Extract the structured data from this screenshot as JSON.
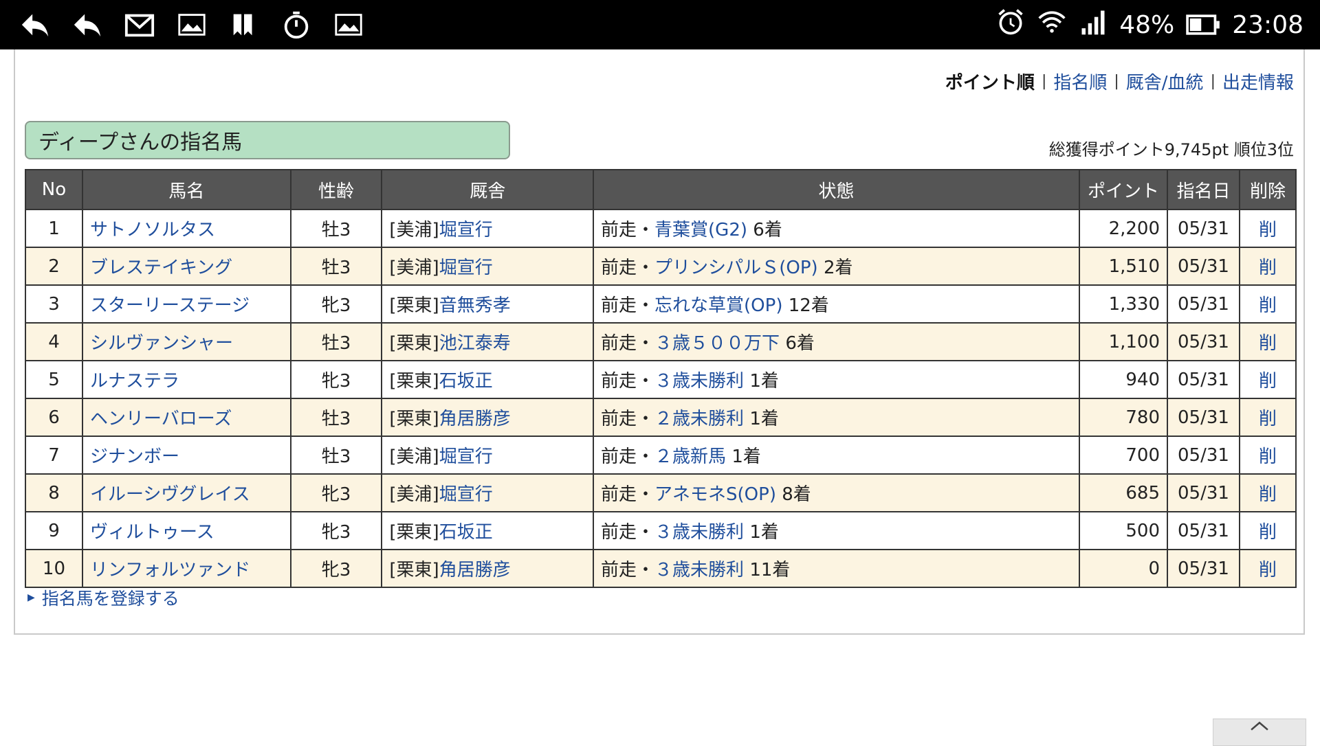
{
  "statusbar": {
    "battery": "48%",
    "time": "23:08"
  },
  "nav": {
    "current": "ポイント順",
    "links": [
      "指名順",
      "厩舎/血統",
      "出走情報"
    ]
  },
  "heading": "ディープさんの指名馬",
  "total": "総獲得ポイント9,745pt 順位3位",
  "columns": [
    "No",
    "馬名",
    "性齢",
    "厩舎",
    "状態",
    "ポイント",
    "指名日",
    "削除"
  ],
  "rows": [
    {
      "no": "1",
      "name": "サトノソルタス",
      "sex": "牡3",
      "stable_pre": "[美浦]",
      "stable": "堀宣行",
      "prefix": "前走・",
      "race": "青葉賞(G2)",
      "result": "6着",
      "points": "2,200",
      "date": "05/31",
      "del": "削"
    },
    {
      "no": "2",
      "name": "ブレステイキング",
      "sex": "牡3",
      "stable_pre": "[美浦]",
      "stable": "堀宣行",
      "prefix": "前走・",
      "race": "プリンシパルＳ(OP)",
      "result": "2着",
      "points": "1,510",
      "date": "05/31",
      "del": "削"
    },
    {
      "no": "3",
      "name": "スターリーステージ",
      "sex": "牝3",
      "stable_pre": "[栗東]",
      "stable": "音無秀孝",
      "prefix": "前走・",
      "race": "忘れな草賞(OP)",
      "result": "12着",
      "points": "1,330",
      "date": "05/31",
      "del": "削"
    },
    {
      "no": "4",
      "name": "シルヴァンシャー",
      "sex": "牡3",
      "stable_pre": "[栗東]",
      "stable": "池江泰寿",
      "prefix": "前走・",
      "race": "３歳５００万下",
      "result": "6着",
      "points": "1,100",
      "date": "05/31",
      "del": "削"
    },
    {
      "no": "5",
      "name": "ルナステラ",
      "sex": "牝3",
      "stable_pre": "[栗東]",
      "stable": "石坂正",
      "prefix": "前走・",
      "race": "３歳未勝利",
      "result": "1着",
      "points": "940",
      "date": "05/31",
      "del": "削"
    },
    {
      "no": "6",
      "name": "ヘンリーバローズ",
      "sex": "牡3",
      "stable_pre": "[栗東]",
      "stable": "角居勝彦",
      "prefix": "前走・",
      "race": "２歳未勝利",
      "result": "1着",
      "points": "780",
      "date": "05/31",
      "del": "削"
    },
    {
      "no": "7",
      "name": "ジナンボー",
      "sex": "牡3",
      "stable_pre": "[美浦]",
      "stable": "堀宣行",
      "prefix": "前走・",
      "race": "２歳新馬",
      "result": "1着",
      "points": "700",
      "date": "05/31",
      "del": "削"
    },
    {
      "no": "8",
      "name": "イルーシヴグレイス",
      "sex": "牝3",
      "stable_pre": "[美浦]",
      "stable": "堀宣行",
      "prefix": "前走・",
      "race": "アネモネS(OP)",
      "result": "8着",
      "points": "685",
      "date": "05/31",
      "del": "削"
    },
    {
      "no": "9",
      "name": "ヴィルトゥース",
      "sex": "牝3",
      "stable_pre": "[栗東]",
      "stable": "石坂正",
      "prefix": "前走・",
      "race": "３歳未勝利",
      "result": "1着",
      "points": "500",
      "date": "05/31",
      "del": "削"
    },
    {
      "no": "10",
      "name": "リンフォルツァンド",
      "sex": "牝3",
      "stable_pre": "[栗東]",
      "stable": "角居勝彦",
      "prefix": "前走・",
      "race": "３歳未勝利",
      "result": "11着",
      "points": "0",
      "date": "05/31",
      "del": "削"
    }
  ],
  "register_link": "指名馬を登録する",
  "icons": [
    "back-arrow-icon",
    "reply-icon",
    "mail-icon",
    "image-icon",
    "bookmark-icon",
    "stopwatch-icon",
    "image-icon",
    "alarm-icon",
    "wifi-icon",
    "signal-icon",
    "battery-icon",
    "chevron-up-icon"
  ],
  "colors": {
    "heading_bg": "#b5e0c3",
    "header_bg": "#555555",
    "row_alt": "#fcf4e1",
    "link": "#1f4e9c"
  }
}
